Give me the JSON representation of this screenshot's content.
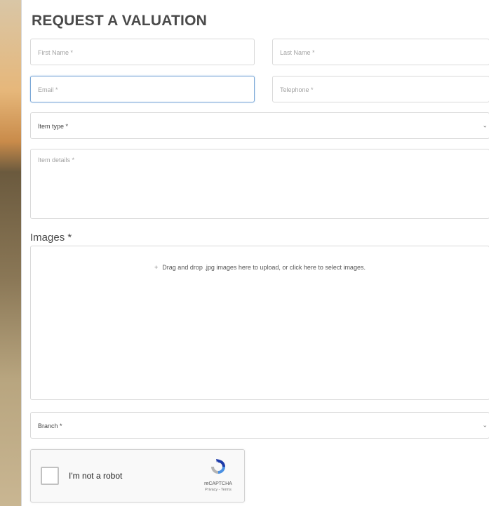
{
  "form": {
    "title": "REQUEST A VALUATION",
    "first_name_placeholder": "First Name *",
    "last_name_placeholder": "Last Name *",
    "email_placeholder": "Email *",
    "telephone_placeholder": "Telephone *",
    "item_type_label": "Item type *",
    "item_details_placeholder": "Item details *",
    "images_label": "Images *",
    "dropzone_text": "Drag and drop .jpg images here to upload, or click here to select images.",
    "branch_label": "Branch *"
  },
  "captcha": {
    "label": "I'm not a robot",
    "brand": "reCAPTCHA",
    "links": "Privacy - Terms"
  },
  "colors": {
    "focus_border": "#7aa7d6",
    "field_border": "#d9d9d9",
    "title": "#4a4a4a"
  }
}
